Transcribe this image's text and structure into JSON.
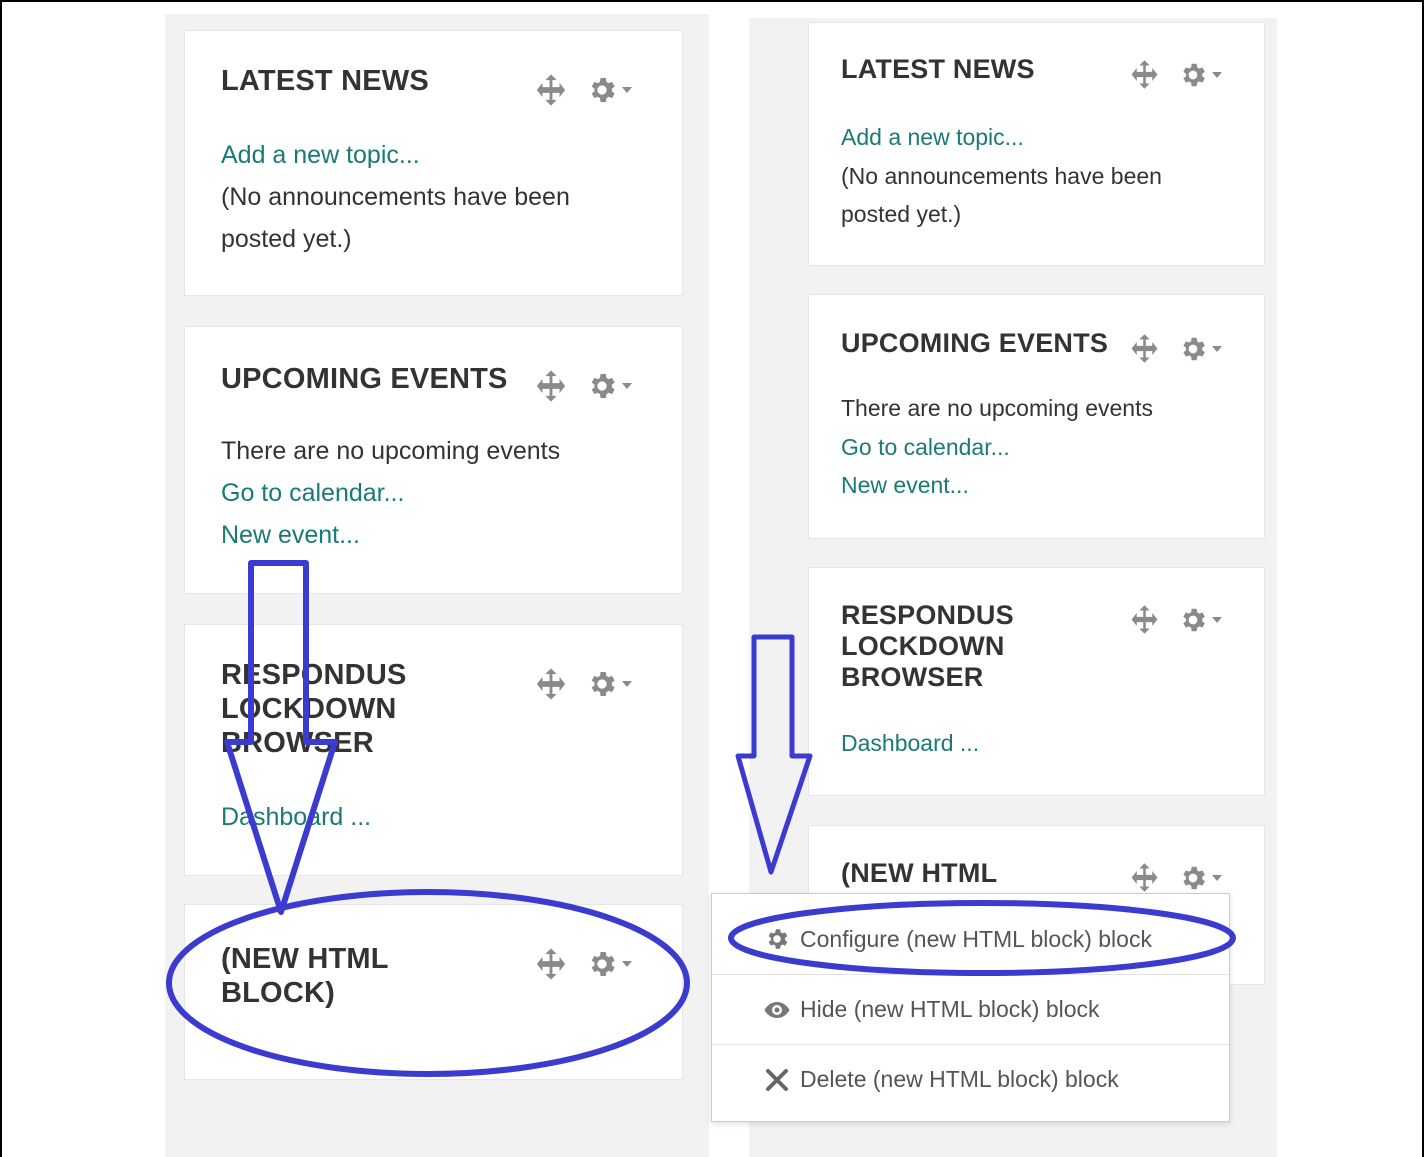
{
  "left_column": {
    "latest_news": {
      "title": "LATEST NEWS",
      "add_topic": "Add a new topic...",
      "no_announcements_1": "(No announcements have been",
      "no_announcements_2": "posted yet.)"
    },
    "upcoming_events": {
      "title": "UPCOMING EVENTS",
      "no_events": "There are no upcoming events",
      "go_to_calendar": "Go to calendar...",
      "new_event": "New event..."
    },
    "respondus": {
      "title_1": "RESPONDUS",
      "title_2": "LOCKDOWN",
      "title_3": "BROWSER",
      "dashboard": "Dashboard ..."
    },
    "html_block": {
      "title_1": "(NEW HTML",
      "title_2": "BLOCK)"
    }
  },
  "right_column": {
    "latest_news": {
      "title": "LATEST NEWS",
      "add_topic": "Add a new topic...",
      "no_announcements_1": "(No announcements have been",
      "no_announcements_2": "posted yet.)"
    },
    "upcoming_events": {
      "title": "UPCOMING EVENTS",
      "no_events": "There are no upcoming events",
      "go_to_calendar": "Go to calendar...",
      "new_event": "New event..."
    },
    "respondus": {
      "title_1": "RESPONDUS",
      "title_2": "LOCKDOWN",
      "title_3": "BROWSER",
      "dashboard": "Dashboard ..."
    },
    "html_block": {
      "title_1": "(NEW HTML"
    }
  },
  "block_menu": {
    "items": [
      {
        "label": "Configure (new HTML block) block",
        "icon": "gear-icon"
      },
      {
        "label": "Hide (new HTML block) block",
        "icon": "eye-icon"
      },
      {
        "label": "Delete (new HTML block) block",
        "icon": "close-icon"
      }
    ]
  },
  "colors": {
    "link": "#1a7a76",
    "annotation": "#3b3bd0",
    "column_background": "#f2f2f2"
  }
}
